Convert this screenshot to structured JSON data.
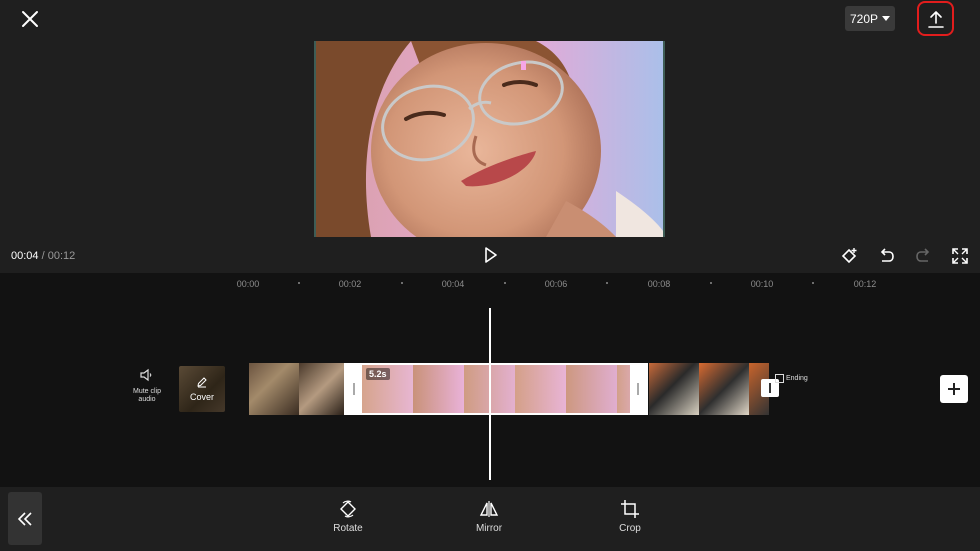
{
  "header": {
    "resolution": "720P"
  },
  "player": {
    "current_time": "00:04",
    "separator": " / ",
    "total_time": "00:12"
  },
  "ruler": {
    "labels": [
      "00:00",
      "00:02",
      "00:04",
      "00:06",
      "00:08",
      "00:10",
      "00:12"
    ]
  },
  "timeline": {
    "mute_label": "Mute clip audio",
    "cover_label": "Cover",
    "selected_clip_duration": "5.2s",
    "ending_label": "Ending"
  },
  "toolbar": {
    "items": [
      {
        "label": "Rotate",
        "icon": "rotate-icon"
      },
      {
        "label": "Mirror",
        "icon": "mirror-icon"
      },
      {
        "label": "Crop",
        "icon": "crop-icon"
      }
    ]
  },
  "colors": {
    "highlight": "#e21d1d",
    "background": "#1f1f1f",
    "timeline_bg": "#121212"
  }
}
